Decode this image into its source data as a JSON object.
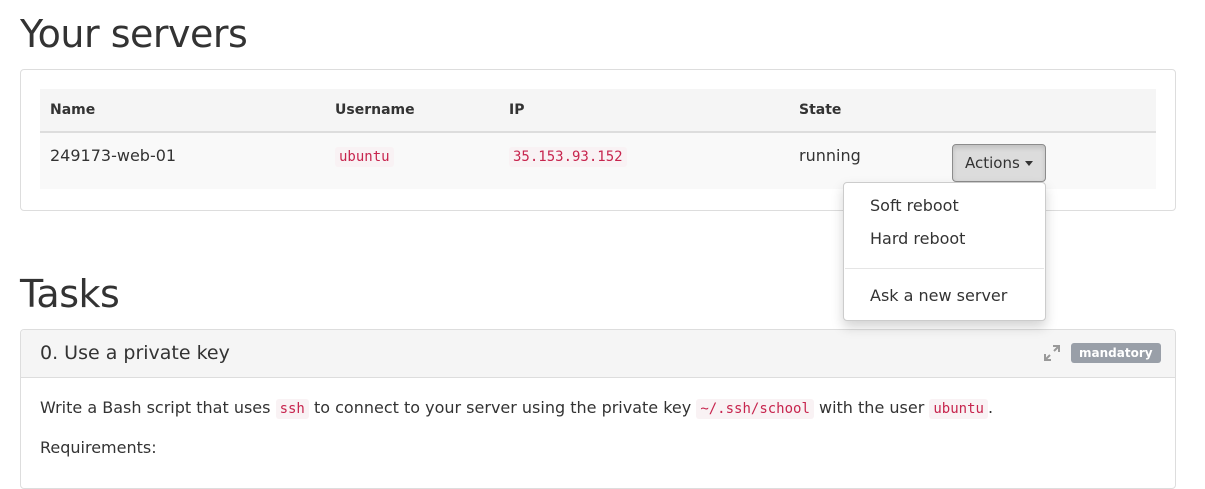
{
  "servers_section": {
    "title": "Your servers",
    "table": {
      "headers": [
        "Name",
        "Username",
        "IP",
        "State"
      ],
      "rows": [
        {
          "name": "249173-web-01",
          "username": "ubuntu",
          "ip": "35.153.93.152",
          "state": "running",
          "actions_label": "Actions"
        }
      ]
    },
    "actions_menu": {
      "items": [
        "Soft reboot",
        "Hard reboot",
        "Ask a new server"
      ]
    }
  },
  "tasks_section": {
    "title": "Tasks",
    "tasks": [
      {
        "title": "0. Use a private key",
        "badge": "mandatory",
        "description": {
          "part1": "Write a Bash script that uses",
          "code1": "ssh",
          "part2": "to connect to your server using the private key",
          "code2": "~/.ssh/school",
          "part3": "with the user",
          "code3": "ubuntu",
          "part4": "."
        },
        "requirements_label": "Requirements:"
      }
    ]
  },
  "icons": {
    "expand": "expand-icon",
    "caret": "caret-down-icon"
  }
}
